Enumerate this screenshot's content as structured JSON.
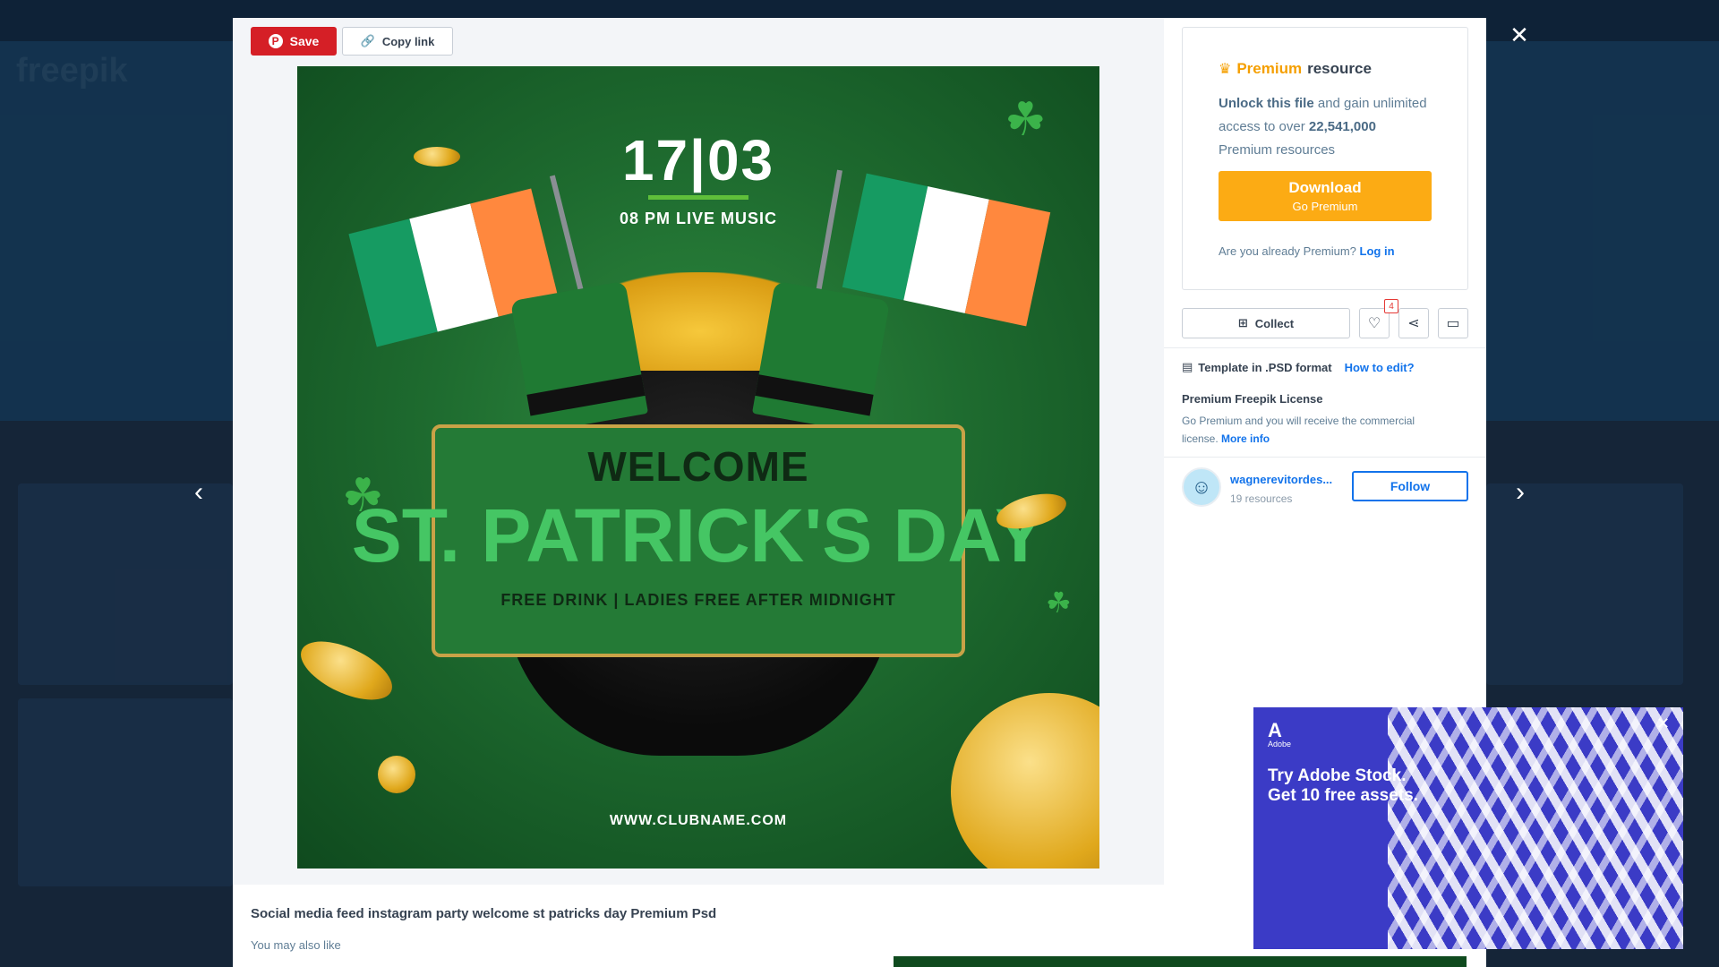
{
  "background": {
    "logo": "freepik"
  },
  "modal": {
    "close_icon": "close-icon",
    "prev_icon": "chevron-left-icon",
    "next_icon": "chevron-right-icon"
  },
  "toolbar": {
    "save_label": "Save",
    "copy_link_label": "Copy link"
  },
  "flyer": {
    "date": "17|03",
    "time": "08 PM LIVE MUSIC",
    "welcome": "WELCOME",
    "headline": "ST. PATRICK'S DAY",
    "tagline": "FREE DRINK | LADIES FREE AFTER MIDNIGHT",
    "url": "WWW.CLUBNAME.COM",
    "colors": {
      "background": "#1e6b2f",
      "headline": "#45c664",
      "flag_green": "#169b62",
      "flag_white": "#ffffff",
      "flag_orange": "#ff883e"
    }
  },
  "info": {
    "title": "Social media feed instagram party welcome st patricks day Premium Psd",
    "also_like": "You may also like"
  },
  "premium": {
    "label_highlight": "Premium",
    "label_rest": "resource",
    "unlock_bold": "Unlock this file",
    "unlock_rest": "and gain unlimited access to over",
    "count": "22,541,000",
    "count_rest": "Premium resources",
    "download_main": "Download",
    "download_sub": "Go Premium",
    "already_text": "Are you already Premium?",
    "login": "Log in"
  },
  "actions": {
    "collect_label": "Collect",
    "like_count": "4"
  },
  "details": {
    "format": "Template in .PSD format",
    "how_to_edit": "How to edit?",
    "license_title": "Premium Freepik License",
    "license_text": "Go Premium and you will receive the commercial license.",
    "more_info": "More info"
  },
  "author": {
    "name": "wagnerevitordes...",
    "resources": "19 resources",
    "follow_label": "Follow"
  },
  "ad": {
    "brand": "Adobe",
    "headline_1": "Try Adobe Stock.",
    "headline_2": "Get 10 free assets.",
    "accent": "#3b3bc6"
  }
}
